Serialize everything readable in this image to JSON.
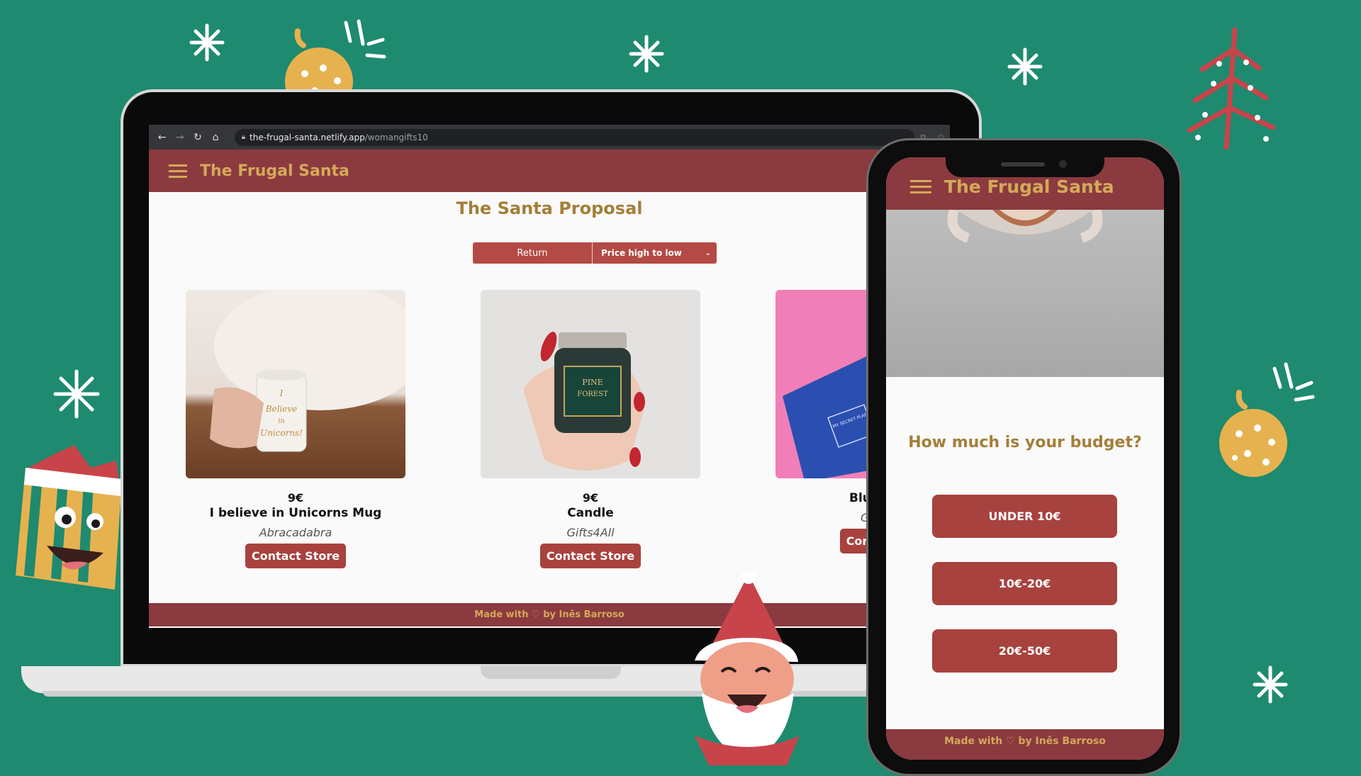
{
  "browser": {
    "url_domain": "the-frugal-santa.netlify.app",
    "url_path": "/womangifts10"
  },
  "site": {
    "title": "The Frugal Santa",
    "page_title": "The Santa Proposal",
    "return_label": "Return",
    "sort_selected": "Price high to low",
    "contact_label": "Contact Store",
    "footer": "Made with ♡ by Inês Barroso"
  },
  "products": [
    {
      "price": "9€",
      "name": "I believe in Unicorns Mug",
      "store": "Abracadabra",
      "mug_text": "I believe in Unicorns!"
    },
    {
      "price": "9€",
      "name": "Candle",
      "store": "Gifts4All",
      "jar_text": "PINE FOREST"
    },
    {
      "price": "",
      "name": "Blu",
      "store": "G",
      "contact_label": "Cor",
      "book_text": "MY SECRET PLAN TO RULE THE WORLD"
    }
  ],
  "phone": {
    "title": "The Frugal Santa",
    "question": "How much is your budget?",
    "options": [
      "UNDER 10€",
      "10€-20€",
      "20€-50€"
    ],
    "footer": "Made with ♡ by Inês Barroso"
  },
  "colors": {
    "background": "#1e8a6f",
    "header": "#8b3a3f",
    "accent_gold": "#d4a95a",
    "button": "#a8423e"
  }
}
